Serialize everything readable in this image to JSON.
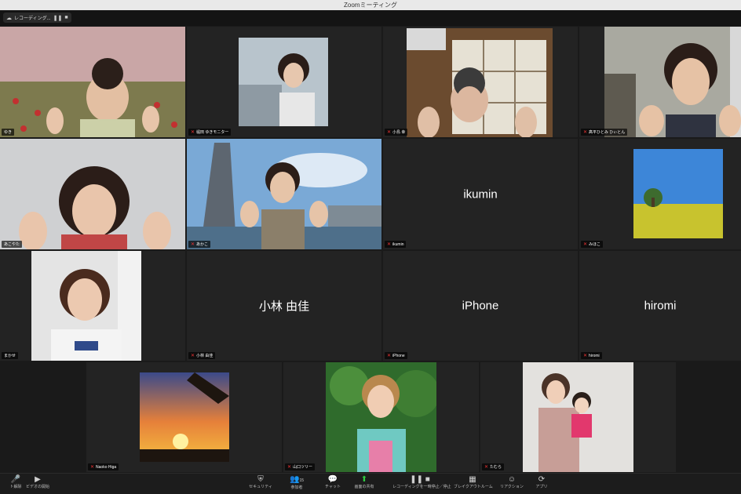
{
  "window": {
    "title": "Zoomミーティング"
  },
  "recording": {
    "label": "レコーディング...",
    "pause_icon": "pause-icon",
    "stop_icon": "stop-icon"
  },
  "participants": [
    {
      "id": "p1",
      "name": "ゆき",
      "video": true
    },
    {
      "id": "p2",
      "name": "堀田 ゆきモニター",
      "video": true
    },
    {
      "id": "p3",
      "name": "小島 幸",
      "video": true
    },
    {
      "id": "p4",
      "name": "髙平ひとみ ひぃとん",
      "video": true
    },
    {
      "id": "p5",
      "name": "あこやた",
      "video": true
    },
    {
      "id": "p6",
      "name": "あかこ",
      "video": true
    },
    {
      "id": "p7",
      "name": "ikumin",
      "display": "ikumin",
      "video": false
    },
    {
      "id": "p8",
      "name": "みほこ",
      "video": true
    },
    {
      "id": "p9",
      "name": "まかせ",
      "video": true
    },
    {
      "id": "p10",
      "name": "小林 由佳",
      "display": "小林 由佳",
      "video": false
    },
    {
      "id": "p11",
      "name": "iPhone",
      "display": "iPhone",
      "video": false
    },
    {
      "id": "p12",
      "name": "hiromi",
      "display": "hiromi",
      "video": false
    },
    {
      "id": "p13",
      "name": "Naoko Higa",
      "video": true
    },
    {
      "id": "p14",
      "name": "山口ツリー",
      "video": true
    },
    {
      "id": "p15",
      "name": "たむら",
      "video": true
    }
  ],
  "toolbar": {
    "items": [
      {
        "id": "mute",
        "label": "ト解除",
        "icon": "microphone-icon"
      },
      {
        "id": "video",
        "label": "ビデオの開始",
        "icon": "video-camera-icon"
      },
      {
        "id": "security",
        "label": "セキュリティ",
        "icon": "shield-icon"
      },
      {
        "id": "participants",
        "label": "参加者",
        "count": "15",
        "icon": "people-icon"
      },
      {
        "id": "chat",
        "label": "チャット",
        "icon": "chat-icon"
      },
      {
        "id": "share",
        "label": "画面の共有",
        "icon": "share-screen-icon"
      },
      {
        "id": "record",
        "label": "レコーディングを一時停止／停止",
        "icon": "record-icon"
      },
      {
        "id": "breakout",
        "label": "ブレイクアウトルーム",
        "icon": "breakout-rooms-icon"
      },
      {
        "id": "reactions",
        "label": "リアクション",
        "icon": "reaction-icon"
      },
      {
        "id": "apps",
        "label": "アプリ",
        "icon": "apps-icon"
      }
    ]
  }
}
